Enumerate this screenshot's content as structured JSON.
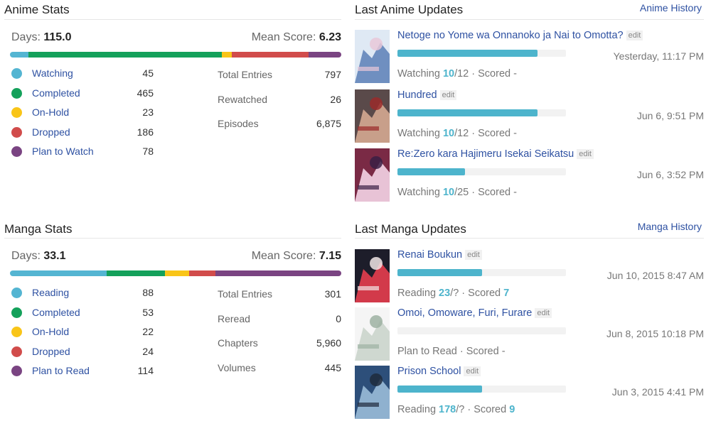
{
  "colors": {
    "watching": "#54b5d2",
    "completed": "#14a15b",
    "on_hold": "#f9c518",
    "dropped": "#d14c4b",
    "planned": "#7a4482",
    "link": "#2e51a2",
    "progress": "#4db4cc"
  },
  "anime_stats": {
    "title": "Anime Stats",
    "days_label": "Days:",
    "days": "115.0",
    "mean_label": "Mean Score:",
    "mean": "6.23",
    "statuses": [
      {
        "label": "Watching",
        "count": "45",
        "key": "watching"
      },
      {
        "label": "Completed",
        "count": "465",
        "key": "completed"
      },
      {
        "label": "On-Hold",
        "count": "23",
        "key": "on_hold"
      },
      {
        "label": "Dropped",
        "count": "186",
        "key": "dropped"
      },
      {
        "label": "Plan to Watch",
        "count": "78",
        "key": "planned"
      }
    ],
    "totals": [
      {
        "label": "Total Entries",
        "value": "797"
      },
      {
        "label": "Rewatched",
        "value": "26"
      },
      {
        "label": "Episodes",
        "value": "6,875"
      }
    ]
  },
  "manga_stats": {
    "title": "Manga Stats",
    "days_label": "Days:",
    "days": "33.1",
    "mean_label": "Mean Score:",
    "mean": "7.15",
    "statuses": [
      {
        "label": "Reading",
        "count": "88",
        "key": "watching"
      },
      {
        "label": "Completed",
        "count": "53",
        "key": "completed"
      },
      {
        "label": "On-Hold",
        "count": "22",
        "key": "on_hold"
      },
      {
        "label": "Dropped",
        "count": "24",
        "key": "dropped"
      },
      {
        "label": "Plan to Read",
        "count": "114",
        "key": "planned"
      }
    ],
    "totals": [
      {
        "label": "Total Entries",
        "value": "301"
      },
      {
        "label": "Reread",
        "value": "0"
      },
      {
        "label": "Chapters",
        "value": "5,960"
      },
      {
        "label": "Volumes",
        "value": "445"
      }
    ]
  },
  "anime_updates": {
    "title": "Last Anime Updates",
    "history_link": "Anime History",
    "edit_label": "edit",
    "items": [
      {
        "title": "Netoge no Yome wa Onnanoko ja Nai to Omotta?",
        "date": "Yesterday, 11:17 PM",
        "status": "Watching",
        "progress": "10",
        "total": "/12",
        "score": "Scored -",
        "fraction": 0.8333
      },
      {
        "title": "Hundred",
        "date": "Jun 6, 9:51 PM",
        "status": "Watching",
        "progress": "10",
        "total": "/12",
        "score": "Scored -",
        "fraction": 0.8333
      },
      {
        "title": "Re:Zero kara Hajimeru Isekai Seikatsu",
        "date": "Jun 6, 3:52 PM",
        "status": "Watching",
        "progress": "10",
        "total": "/25",
        "score": "Scored -",
        "fraction": 0.4
      }
    ]
  },
  "manga_updates": {
    "title": "Last Manga Updates",
    "history_link": "Manga History",
    "edit_label": "edit",
    "items": [
      {
        "title": "Renai Boukun",
        "date": "Jun 10, 2015 8:47 AM",
        "status_prefix": "Reading",
        "progress": "23",
        "total": "/?",
        "score_prefix": "Scored",
        "score": "7",
        "fraction": 0.5
      },
      {
        "title": "Omoi, Omoware, Furi, Furare",
        "date": "Jun 8, 2015 10:18 PM",
        "status_prefix": "Plan to Read",
        "progress": "",
        "total": "",
        "score_prefix": "Scored",
        "score": "-",
        "fraction": 0
      },
      {
        "title": "Prison School",
        "date": "Jun 3, 2015 4:41 PM",
        "status_prefix": "Reading",
        "progress": "178",
        "total": "/?",
        "score_prefix": "Scored",
        "score": "9",
        "fraction": 0.5
      }
    ]
  }
}
